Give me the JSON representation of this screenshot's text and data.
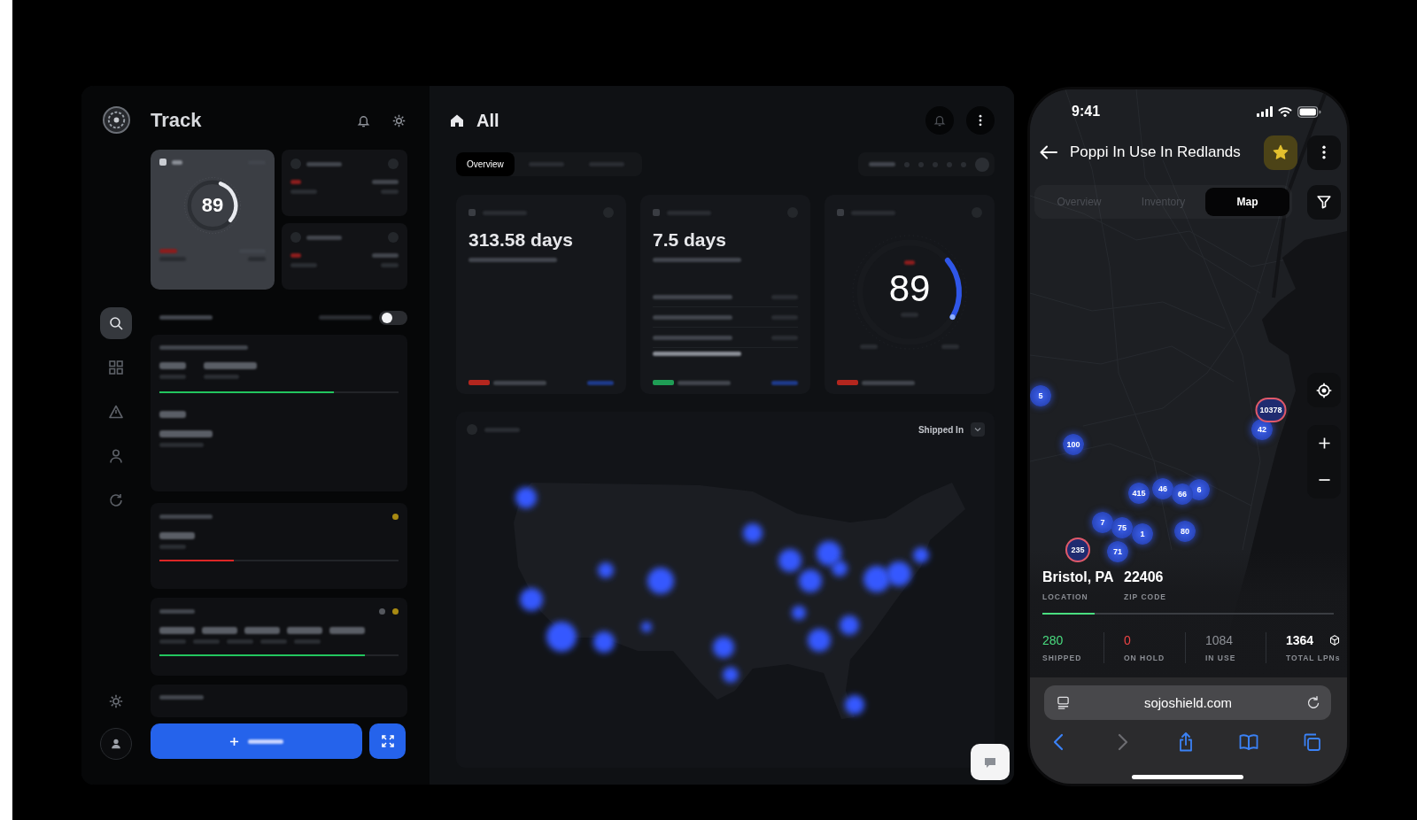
{
  "dashboard": {
    "sidebar": {
      "title": "Track",
      "rail": [
        {
          "kind": "search",
          "selected": true
        },
        {
          "kind": "grid",
          "selected": false
        },
        {
          "kind": "alert",
          "selected": false
        },
        {
          "kind": "person",
          "selected": false
        },
        {
          "kind": "refresh",
          "selected": false
        }
      ],
      "gauge_card": {
        "value": "89"
      },
      "toggle": {
        "on": false
      },
      "progress_cards": [
        {
          "level": 0.73,
          "color": "#22c55e"
        },
        {
          "level": 0.31,
          "color": "#dc2626"
        },
        {
          "level": 0.86,
          "color": "#22c55e"
        }
      ]
    },
    "main": {
      "title": "All",
      "tabs": [
        {
          "label": "Overview",
          "selected": true
        },
        {
          "selected": false
        },
        {
          "selected": false
        }
      ],
      "cards": [
        {
          "kind": "stat",
          "value": "313.58 days",
          "color": "#b3261e"
        },
        {
          "kind": "list",
          "value": "7.5 days",
          "color": "#1f9d55"
        },
        {
          "kind": "gauge",
          "value": "89",
          "color": "#b3261e"
        }
      ],
      "map_card": {
        "filter_label": "Shipped In"
      }
    }
  },
  "phone": {
    "status_bar": {
      "time": "9:41"
    },
    "header": {
      "title": "Poppi In Use In Redlands",
      "favorite": true
    },
    "tabs": [
      {
        "label": "Overview",
        "selected": false
      },
      {
        "label": "Inventory",
        "selected": false
      },
      {
        "label": "Map",
        "selected": true
      }
    ],
    "map": {
      "markers": [
        {
          "count": "5",
          "alert": false
        },
        {
          "count": "100",
          "alert": false
        },
        {
          "count": "415",
          "alert": false
        },
        {
          "count": "46",
          "alert": false
        },
        {
          "count": "6",
          "alert": false
        },
        {
          "count": "66",
          "alert": false
        },
        {
          "count": "7",
          "alert": false
        },
        {
          "count": "75",
          "alert": false
        },
        {
          "count": "1",
          "alert": false
        },
        {
          "count": "80",
          "alert": false
        },
        {
          "count": "235",
          "alert": true
        },
        {
          "count": "71",
          "alert": false
        },
        {
          "count": "42",
          "alert": false
        },
        {
          "count": "10378",
          "alert": true
        }
      ]
    },
    "location": {
      "value": "Bristol, PA",
      "label": "LOCATION"
    },
    "zip": {
      "value": "22406",
      "label": "ZIP CODE"
    },
    "progress": {
      "level": 0.18
    },
    "stats": [
      {
        "kind": "count",
        "value": "280",
        "label": "SHIPPED",
        "color": "#4ade80"
      },
      {
        "kind": "count",
        "value": "0",
        "label": "ON HOLD",
        "color": "#ef4444"
      },
      {
        "kind": "count",
        "value": "1084",
        "label": "IN USE",
        "color": "#8e9197"
      },
      {
        "kind": "total",
        "value": "1364",
        "label": "TOTAL LPNs",
        "color": "#ffffff"
      }
    ],
    "browser": {
      "url": "sojoshield.com",
      "toolbar": [
        {
          "kind": "back",
          "disabled": false
        },
        {
          "kind": "forward",
          "disabled": true
        },
        {
          "kind": "share",
          "disabled": false
        },
        {
          "kind": "bookmarks",
          "disabled": false
        },
        {
          "kind": "tabs",
          "disabled": false
        }
      ]
    }
  }
}
